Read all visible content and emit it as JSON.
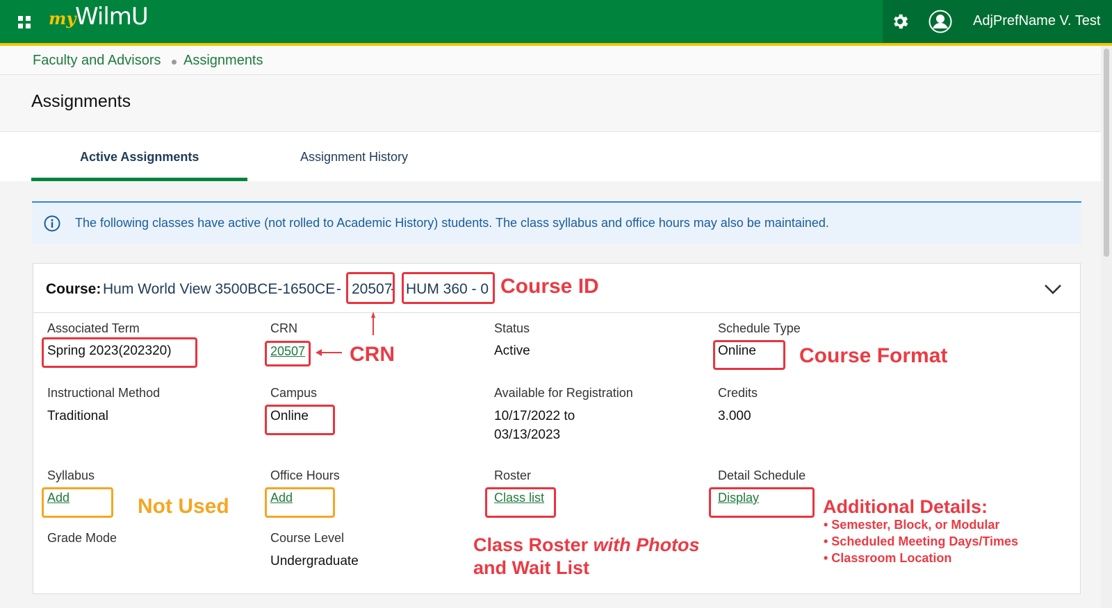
{
  "header": {
    "logo_my": "my",
    "logo_wilmu": "WilmU",
    "user_name": "AdjPrefName V. Test",
    "brand_green": "#00843d",
    "brand_gold": "#f5c400"
  },
  "breadcrumb": {
    "items": [
      "Faculty and Advisors",
      "Assignments"
    ]
  },
  "page": {
    "title": "Assignments"
  },
  "tabs": [
    {
      "label": "Active Assignments",
      "active": true
    },
    {
      "label": "Assignment History",
      "active": false
    }
  ],
  "info": {
    "text": "The following classes have active (not rolled to Academic History) students. The class syllabus and office hours may also be maintained."
  },
  "course": {
    "label": "Course:",
    "name": "Hum World View 3500BCE-1650CE",
    "separator": "-",
    "crn": "20507",
    "number": "HUM 360 - 0"
  },
  "fields": {
    "associated_term": {
      "label": "Associated Term",
      "value": "Spring 2023(202320)"
    },
    "crn": {
      "label": "CRN",
      "value": "20507"
    },
    "status": {
      "label": "Status",
      "value": "Active"
    },
    "schedule_type": {
      "label": "Schedule Type",
      "value": "Online"
    },
    "instructional_method": {
      "label": "Instructional Method",
      "value": "Traditional"
    },
    "campus": {
      "label": "Campus",
      "value": "Online"
    },
    "available_registration": {
      "label": "Available for Registration",
      "value_line1": "10/17/2022 to",
      "value_line2": "03/13/2023"
    },
    "credits": {
      "label": "Credits",
      "value": "3.000"
    },
    "syllabus": {
      "label": "Syllabus",
      "link": "Add"
    },
    "office_hours": {
      "label": "Office Hours",
      "link": "Add"
    },
    "roster": {
      "label": "Roster",
      "link": "Class list"
    },
    "detail_schedule": {
      "label": "Detail Schedule",
      "link": "Display"
    },
    "grade_mode": {
      "label": "Grade Mode"
    },
    "course_level": {
      "label": "Course Level",
      "value": "Undergraduate"
    }
  },
  "annotations": {
    "course_id": "Course ID",
    "crn": "CRN",
    "course_format": "Course Format",
    "not_used": "Not Used",
    "roster_line1_a": "Class Roster ",
    "roster_line1_b": "with Photos",
    "roster_line2": "and Wait List",
    "additional_title": "Additional Details:",
    "additional_items": [
      "• Semester, Block, or Modular",
      "• Scheduled Meeting Days/Times",
      "• Classroom Location"
    ],
    "red": "#ea3b44",
    "orange": "#f5a623"
  }
}
